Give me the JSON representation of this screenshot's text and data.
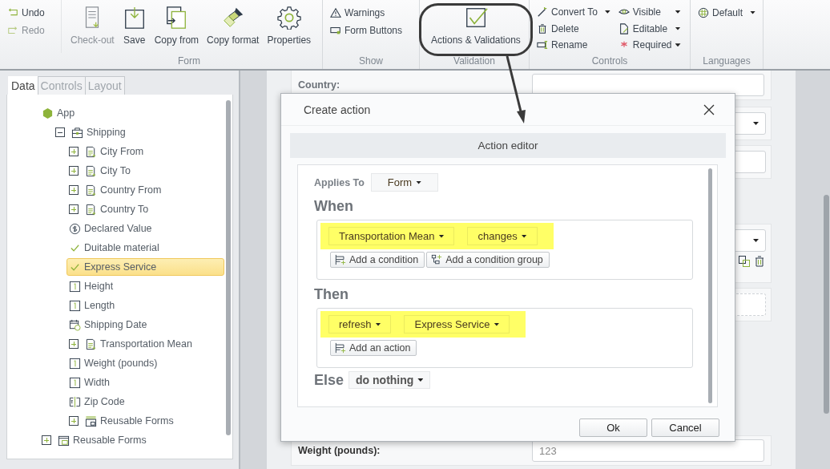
{
  "ribbon": {
    "groups": [
      {
        "title": "Form",
        "columns": [
          [
            {
              "kind": "small",
              "label": "Undo",
              "disabled": false,
              "dropdown": false
            },
            {
              "kind": "small",
              "label": "Redo",
              "disabled": true,
              "dropdown": false
            }
          ],
          [
            {
              "kind": "large",
              "label": "Check-out",
              "disabled": true
            }
          ],
          [
            {
              "kind": "large",
              "label": "Save",
              "disabled": false
            }
          ],
          [
            {
              "kind": "large",
              "label": "Copy from",
              "disabled": false
            }
          ],
          [
            {
              "kind": "large",
              "label": "Copy format",
              "disabled": false
            }
          ],
          [
            {
              "kind": "large",
              "label": "Properties",
              "disabled": false
            }
          ]
        ]
      },
      {
        "title": "Show",
        "columns": [
          [
            {
              "kind": "small",
              "label": "Warnings",
              "disabled": false,
              "dropdown": false
            },
            {
              "kind": "small",
              "label": "Form Buttons",
              "disabled": false,
              "dropdown": false
            }
          ]
        ]
      },
      {
        "title": "Validation",
        "columns": [
          [
            {
              "kind": "large",
              "label": "Actions & Validations",
              "disabled": false
            }
          ]
        ]
      },
      {
        "title": "Controls",
        "columns": [
          [
            {
              "kind": "small",
              "label": "Convert To",
              "disabled": false,
              "dropdown": true
            },
            {
              "kind": "small",
              "label": "Delete",
              "disabled": false,
              "dropdown": false
            },
            {
              "kind": "small",
              "label": "Rename",
              "disabled": false,
              "dropdown": false
            }
          ],
          [
            {
              "kind": "small",
              "label": "Visible",
              "disabled": false,
              "dropdown": true
            },
            {
              "kind": "small",
              "label": "Editable",
              "disabled": false,
              "dropdown": true
            },
            {
              "kind": "small",
              "label": "Required",
              "disabled": false,
              "dropdown": true
            }
          ]
        ]
      },
      {
        "title": "Languages",
        "columns": [
          [
            {
              "kind": "small",
              "label": "Default",
              "disabled": false,
              "dropdown": true
            }
          ]
        ]
      }
    ]
  },
  "panel": {
    "tabs": [
      {
        "label": "Data",
        "selected": true
      },
      {
        "label": "Controls",
        "selected": false
      },
      {
        "label": "Layout",
        "selected": false
      }
    ],
    "tree": [
      {
        "label": "App",
        "kind": "app",
        "selected": false,
        "children": [
          {
            "label": "Shipping",
            "kind": "group",
            "expanded": true,
            "selected": false,
            "children": [
              {
                "label": "City From",
                "kind": "list",
                "expanded": false,
                "selected": false
              },
              {
                "label": "City To",
                "kind": "list",
                "expanded": false,
                "selected": false
              },
              {
                "label": "Country From",
                "kind": "list",
                "expanded": false,
                "selected": false
              },
              {
                "label": "Country To",
                "kind": "list",
                "expanded": false,
                "selected": false
              },
              {
                "label": "Declared Value",
                "kind": "currency",
                "selected": false
              },
              {
                "label": "Duitable material",
                "kind": "check",
                "selected": false
              },
              {
                "label": "Express Service",
                "kind": "check",
                "selected": true
              },
              {
                "label": "Height",
                "kind": "number",
                "selected": false
              },
              {
                "label": "Length",
                "kind": "number",
                "selected": false
              },
              {
                "label": "Shipping Date",
                "kind": "date",
                "selected": false
              },
              {
                "label": "Transportation Mean",
                "kind": "list",
                "expanded": false,
                "selected": false
              },
              {
                "label": "Weight (pounds)",
                "kind": "number",
                "selected": false
              },
              {
                "label": "Width",
                "kind": "number",
                "selected": false
              },
              {
                "label": "Zip Code",
                "kind": "text",
                "selected": false
              },
              {
                "label": "Reusable Forms",
                "kind": "forms",
                "expanded": false,
                "selected": false
              }
            ]
          }
        ]
      },
      {
        "label": "Reusable Forms",
        "kind": "forms",
        "expanded": false,
        "selected": false
      }
    ]
  },
  "form": {
    "top_label": "Country:",
    "bottom_label": "Weight (pounds):",
    "bottom_value": "123"
  },
  "dialog": {
    "title": "Create action",
    "header": "Action editor",
    "applies_label": "Applies To",
    "applies_value": "Form",
    "sections": [
      {
        "heading": "When",
        "highlighted": true,
        "dropdowns": [
          {
            "text": "Transportation Mean"
          },
          {
            "text": "changes"
          }
        ],
        "buttons": [
          {
            "label": "Add a condition"
          },
          {
            "label": "Add a condition group"
          }
        ]
      },
      {
        "heading": "Then",
        "highlighted": true,
        "dropdowns": [
          {
            "text": "refresh"
          },
          {
            "text": "Express Service"
          }
        ],
        "buttons": [
          {
            "label": "Add an action"
          }
        ]
      }
    ],
    "else_label": "Else",
    "else_value": "do nothing",
    "buttons": [
      "Ok",
      "Cancel"
    ]
  }
}
